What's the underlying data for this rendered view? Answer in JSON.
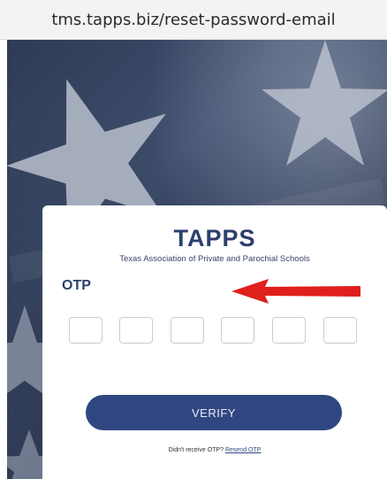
{
  "browser": {
    "url": "tms.tapps.biz/reset-password-email"
  },
  "brand": {
    "logo": "TAPPS",
    "subtitle": "Texas Association of Private and Parochial Schools",
    "color": "#2c3f6e"
  },
  "form": {
    "otp_label": "OTP",
    "otp_digits": [
      "",
      "",
      "",
      "",
      "",
      ""
    ],
    "verify_label": "VERIFY",
    "resend_prompt": "Didn't receive OTP?",
    "resend_link": "Resend OTP"
  },
  "annotation": {
    "icon": "red-arrow-icon",
    "color": "#e0201c"
  }
}
